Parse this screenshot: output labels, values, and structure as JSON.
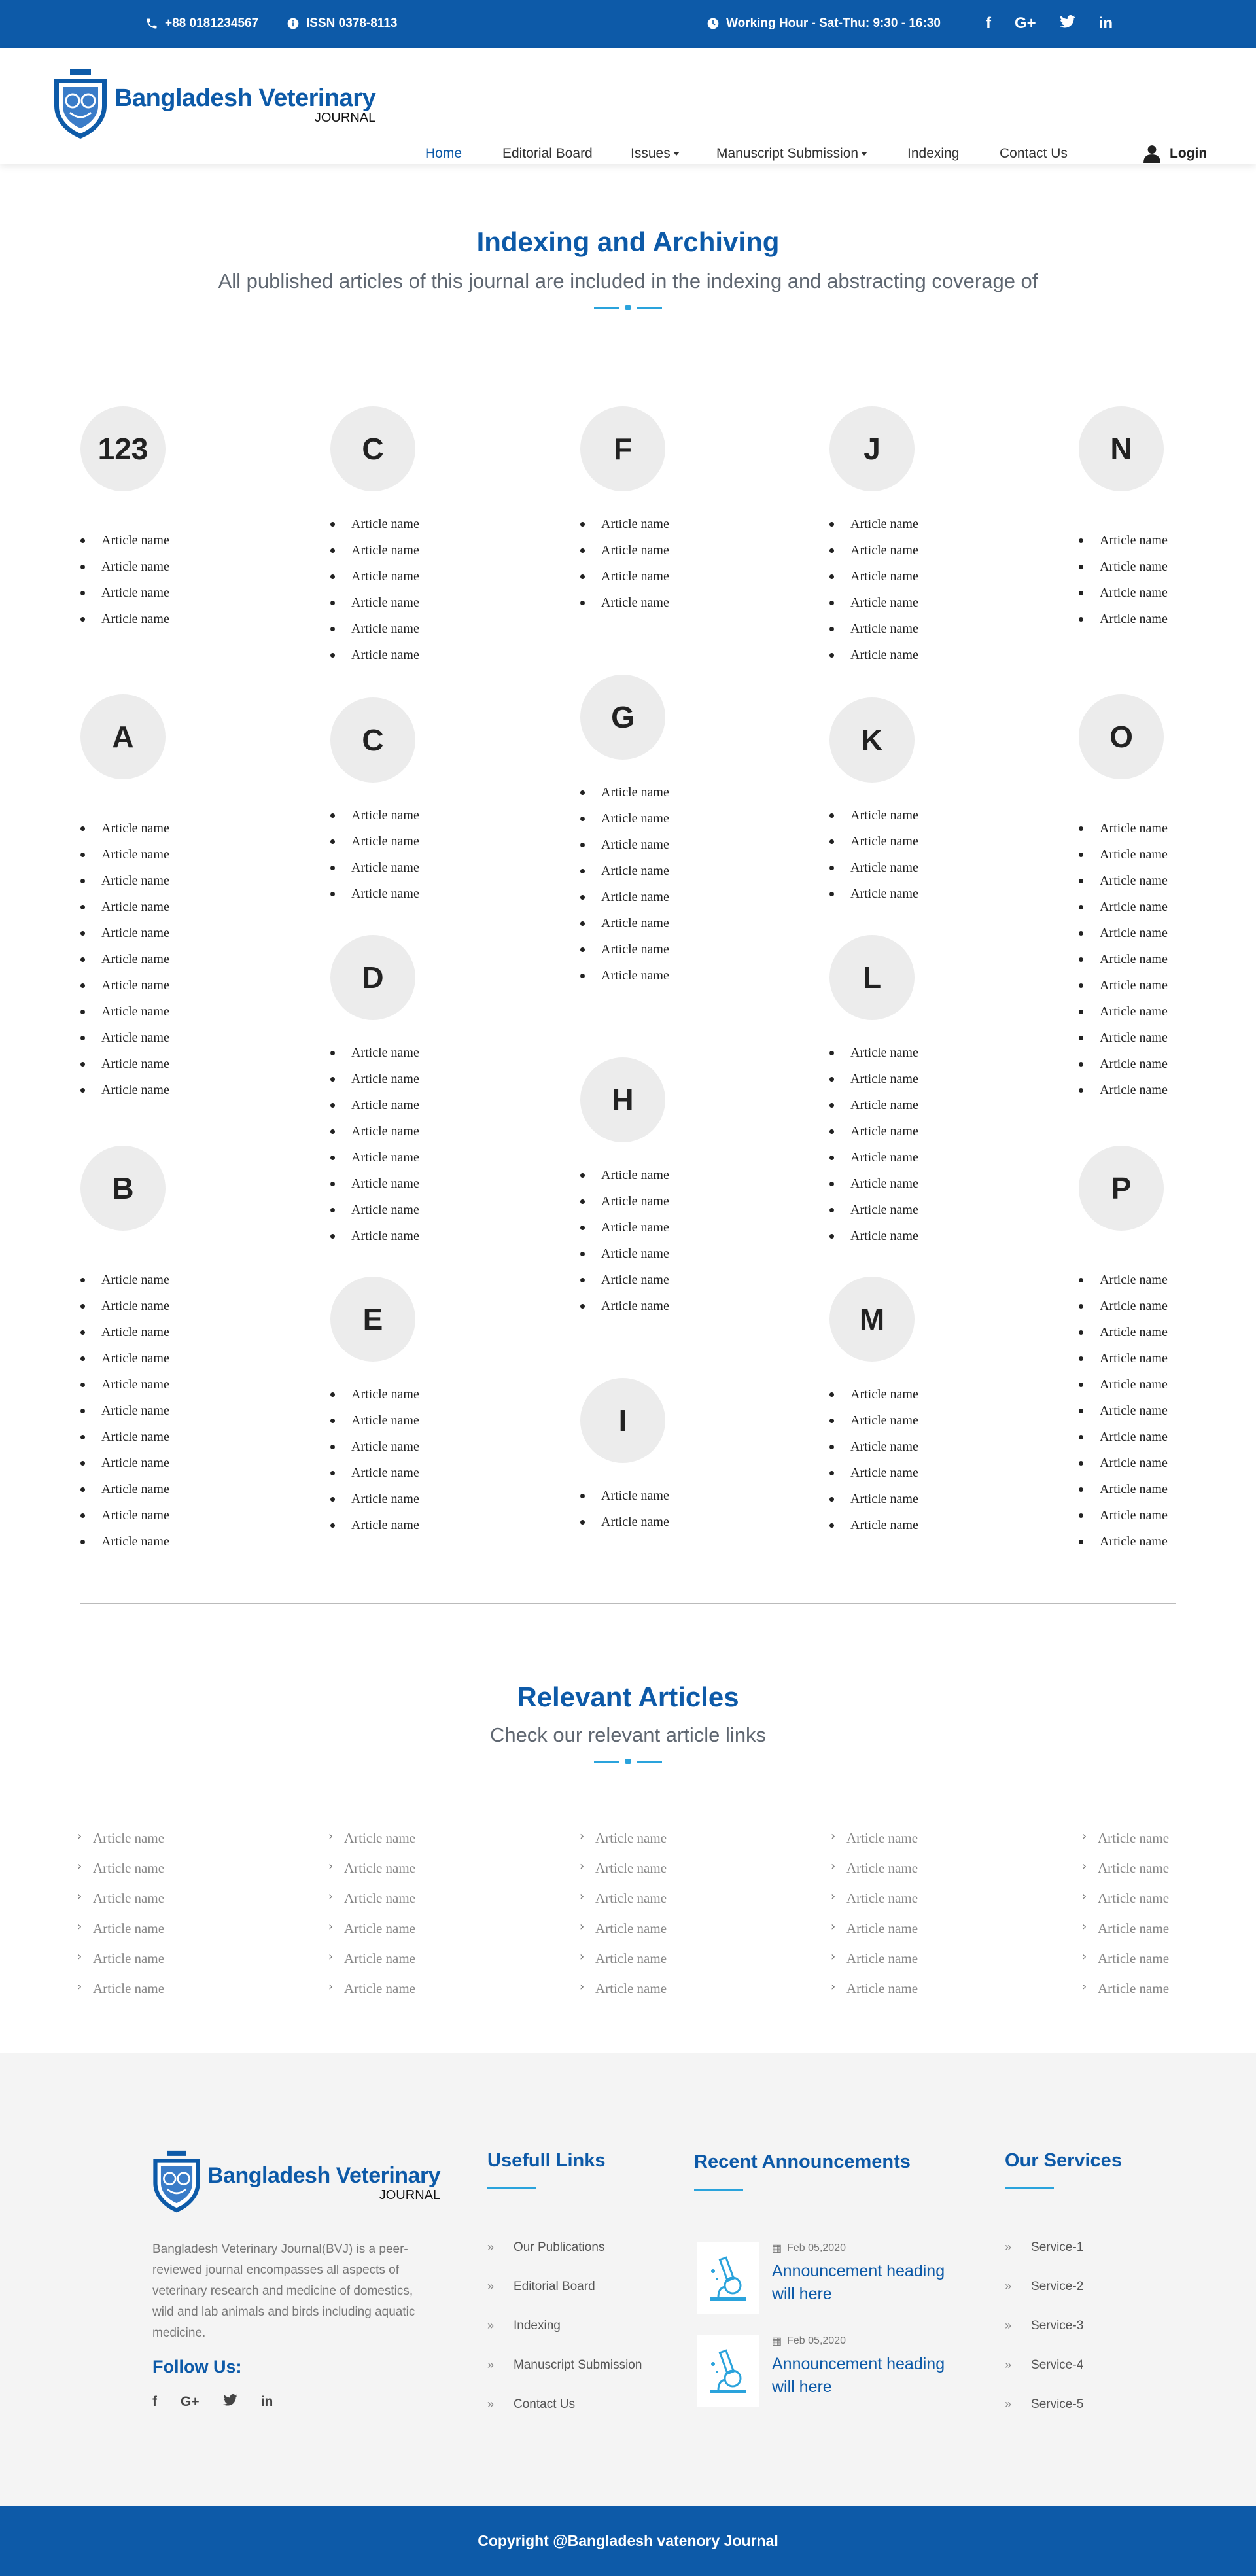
{
  "topbar": {
    "phone": "+88 0181234567",
    "issn": "ISSN 0378-8113",
    "hours": "Working Hour - Sat-Thu: 9:30 - 16:30",
    "social": [
      "f",
      "G+",
      "t",
      "in"
    ]
  },
  "header": {
    "logo_title": "Bangladesh Veterinary",
    "logo_sub": "JOURNAL",
    "nav": [
      {
        "label": "Home"
      },
      {
        "label": "Editorial Board"
      },
      {
        "label": "Issues"
      },
      {
        "label": "Manuscript Submission"
      },
      {
        "label": "Indexing"
      },
      {
        "label": "Contact Us"
      }
    ],
    "login": "Login"
  },
  "indexing": {
    "title": "Indexing and Archiving",
    "subtitle": "All published articles of this journal are included in the indexing and abstracting coverage of",
    "item_label": "Article name",
    "columns": [
      [
        {
          "letter": "123",
          "count": 4
        },
        {
          "letter": "A",
          "count": 11
        },
        {
          "letter": "B",
          "count": 11
        }
      ],
      [
        {
          "letter": "C",
          "count": 6
        },
        {
          "letter": "C",
          "count": 4
        },
        {
          "letter": "D",
          "count": 8
        },
        {
          "letter": "E",
          "count": 6
        }
      ],
      [
        {
          "letter": "F",
          "count": 4
        },
        {
          "letter": "G",
          "count": 8
        },
        {
          "letter": "H",
          "count": 6
        },
        {
          "letter": "I",
          "count": 2
        }
      ],
      [
        {
          "letter": "J",
          "count": 6
        },
        {
          "letter": "K",
          "count": 4
        },
        {
          "letter": "L",
          "count": 8
        },
        {
          "letter": "M",
          "count": 6
        }
      ],
      [
        {
          "letter": "N",
          "count": 4
        },
        {
          "letter": "O",
          "count": 11
        },
        {
          "letter": "P",
          "count": 11
        }
      ]
    ]
  },
  "relevant": {
    "title": "Relevant Articles",
    "subtitle": "Check our relevant article links",
    "item_label": "Article name",
    "columns": 5,
    "rows": 6
  },
  "footer": {
    "logo_title": "Bangladesh Veterinary",
    "logo_sub": "JOURNAL",
    "description": "Bangladesh Veterinary Journal(BVJ) is a peer-reviewed journal encompasses all aspects of veterinary research and medicine of domestics, wild and lab animals and birds including aquatic medicine.",
    "follow_us": "Follow Us:",
    "social": [
      "f",
      "G+",
      "t",
      "in"
    ],
    "useful_links_title": "Usefull Links",
    "useful_links": [
      "Our Publications",
      "Editorial Board",
      "Indexing",
      "Manuscript Submission",
      "Contact Us"
    ],
    "announcements_title": "Recent Announcements",
    "announcements": [
      {
        "date": "Feb 05,2020",
        "heading": "Announcement heading will here"
      },
      {
        "date": "Feb 05,2020",
        "heading": "Announcement heading will here"
      }
    ],
    "services_title": "Our Services",
    "services": [
      "Service-1",
      "Service-2",
      "Service-3",
      "Service-4",
      "Service-5"
    ]
  },
  "copyright": "Copyright @Bangladesh vatenory Journal",
  "colors": {
    "brand": "#0d5aa8",
    "accent": "#2aa3dc"
  }
}
